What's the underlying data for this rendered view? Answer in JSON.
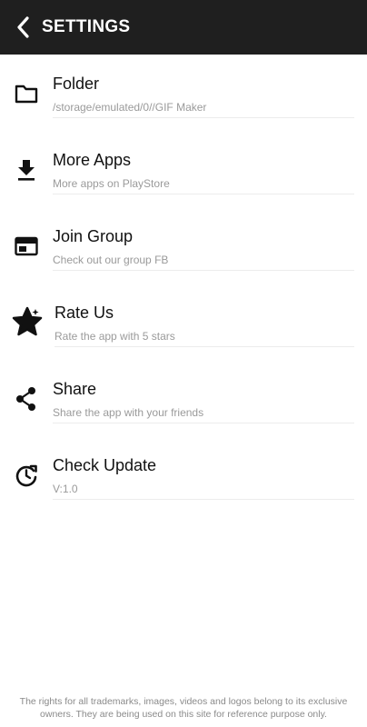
{
  "header": {
    "title": "SETTINGS",
    "back_icon": "chevron-left-icon"
  },
  "items": [
    {
      "title": "Folder",
      "subtitle": "/storage/emulated/0//GIF Maker",
      "icon": "folder-icon"
    },
    {
      "title": "More Apps",
      "subtitle": "More apps on PlayStore",
      "icon": "download-icon"
    },
    {
      "title": "Join Group",
      "subtitle": "Check out our group FB",
      "icon": "browser-window-icon"
    },
    {
      "title": "Rate Us",
      "subtitle": "Rate the app with 5 stars",
      "icon": "star-icon"
    },
    {
      "title": "Share",
      "subtitle": "Share the app with your friends",
      "icon": "share-icon"
    },
    {
      "title": "Check Update",
      "subtitle": "V:1.0",
      "icon": "update-clock-icon"
    }
  ],
  "footer": {
    "disclaimer": "The rights for all trademarks, images, videos and logos belong to its exclusive owners. They are being used on this site for reference purpose only."
  },
  "colors": {
    "appbar": "#1f1f1f",
    "title_text": "#111111",
    "subtitle_text": "#9a9a9a"
  }
}
